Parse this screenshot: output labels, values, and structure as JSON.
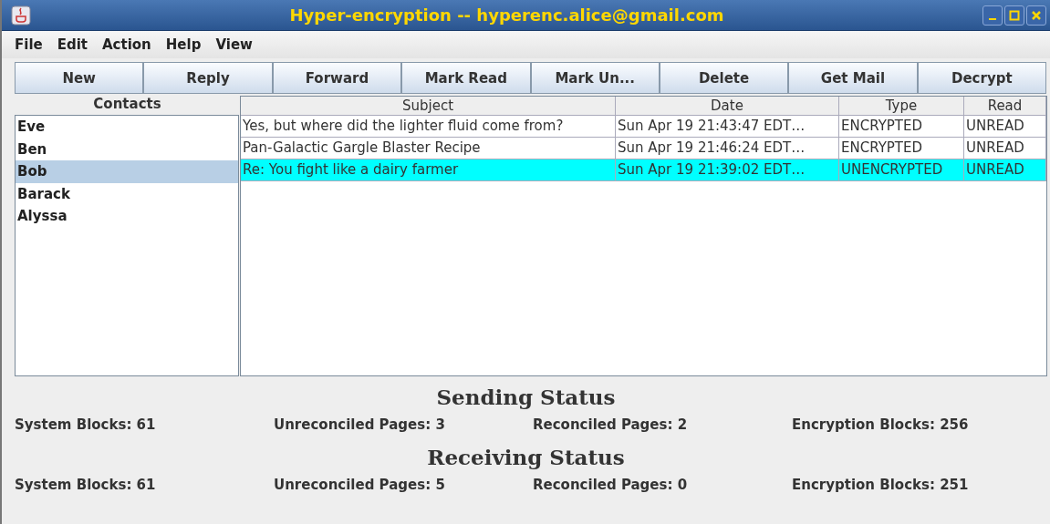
{
  "window": {
    "title": "Hyper-encryption -- hyperenc.alice@gmail.com"
  },
  "menu": [
    "File",
    "Edit",
    "Action",
    "Help",
    "View"
  ],
  "toolbar": [
    "New",
    "Reply",
    "Forward",
    "Mark Read",
    "Mark Un...",
    "Delete",
    "Get Mail",
    "Decrypt"
  ],
  "contacts": {
    "header": "Contacts",
    "items": [
      {
        "name": "Eve",
        "selected": false
      },
      {
        "name": "Ben",
        "selected": false
      },
      {
        "name": "Bob",
        "selected": true
      },
      {
        "name": "Barack",
        "selected": false
      },
      {
        "name": "Alyssa",
        "selected": false
      }
    ]
  },
  "messages": {
    "columns": [
      "Subject",
      "Date",
      "Type",
      "Read"
    ],
    "rows": [
      {
        "cells": [
          "Yes, but where did the lighter fluid come from?",
          "Sun Apr 19 21:43:47 EDT…",
          "ENCRYPTED",
          "UNREAD"
        ],
        "selected": false
      },
      {
        "cells": [
          "Pan-Galactic Gargle Blaster Recipe",
          "Sun Apr 19 21:46:24 EDT…",
          "ENCRYPTED",
          "UNREAD"
        ],
        "selected": false
      },
      {
        "cells": [
          "Re: You fight like a dairy farmer",
          "Sun Apr 19 21:39:02 EDT…",
          "UNENCRYPTED",
          "UNREAD"
        ],
        "selected": true
      }
    ]
  },
  "status": [
    {
      "title": "Sending Status",
      "fields": [
        "System Blocks: 61",
        "Unreconciled Pages: 3",
        "Reconciled Pages: 2",
        "Encryption Blocks: 256"
      ]
    },
    {
      "title": "Receiving Status",
      "fields": [
        "System Blocks: 61",
        "Unreconciled Pages: 5",
        "Reconciled Pages: 0",
        "Encryption Blocks: 251"
      ]
    }
  ]
}
